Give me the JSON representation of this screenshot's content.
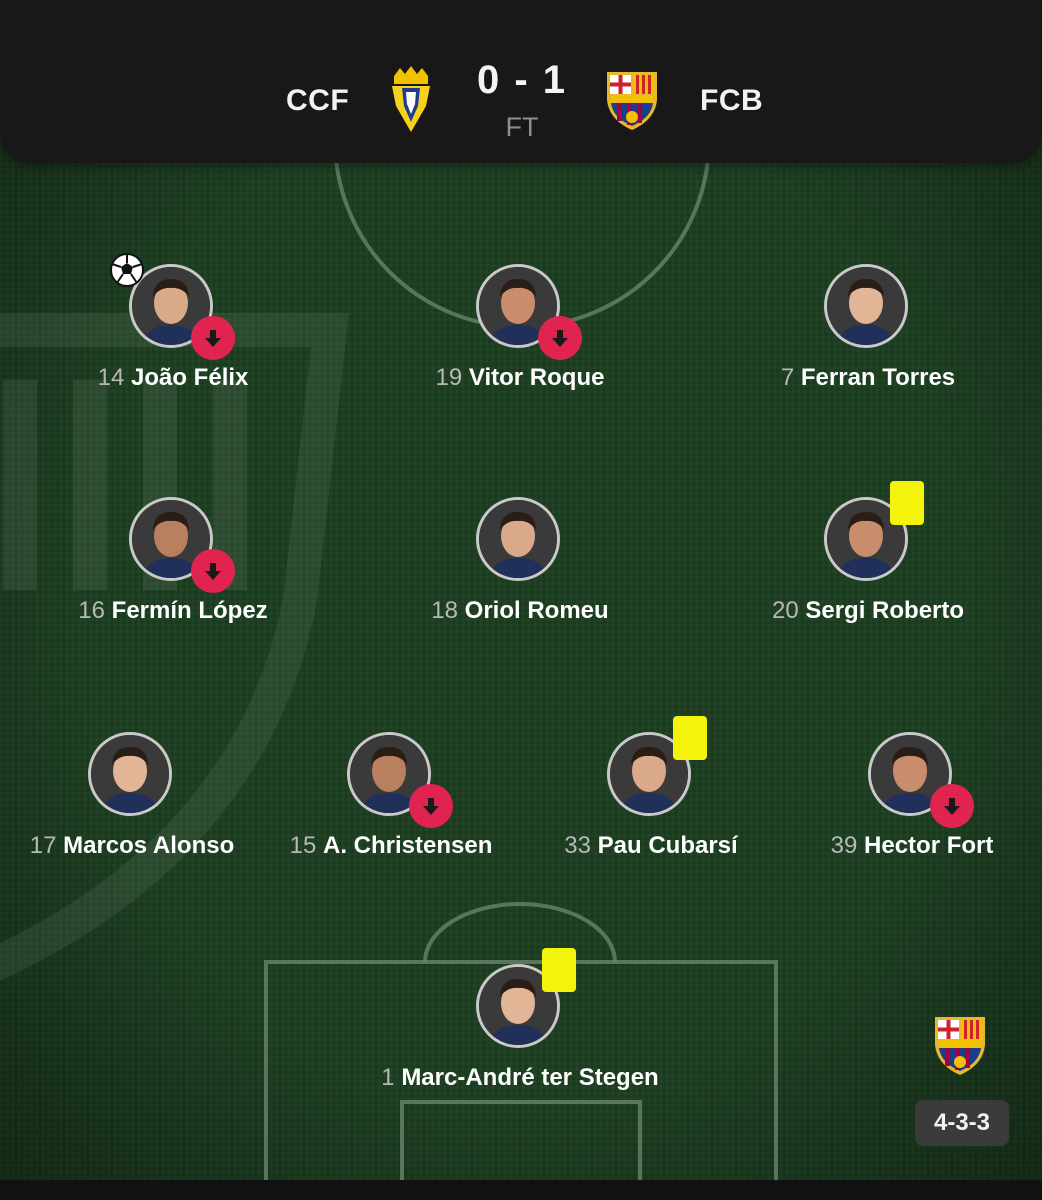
{
  "match": {
    "home_code": "CCF",
    "away_code": "FCB",
    "score": "0 - 1",
    "status": "FT"
  },
  "colors": {
    "pitch": "#1b3a1f",
    "header_bg": "#181818",
    "sub_off_badge": "#e1234f",
    "yellow_card": "#f3f30c",
    "badge_bg": "#3b3b3b"
  },
  "formation": "4-3-3",
  "players": [
    {
      "id": "joao-felix",
      "number": "14",
      "name": "João Félix",
      "icons": [
        "goal-ball-icon",
        "substitution-off-icon"
      ]
    },
    {
      "id": "vitor-roque",
      "number": "19",
      "name": "Vitor Roque",
      "icons": [
        "substitution-off-icon"
      ]
    },
    {
      "id": "ferran-torres",
      "number": "7",
      "name": "Ferran Torres",
      "icons": []
    },
    {
      "id": "fermin-lopez",
      "number": "16",
      "name": "Fermín López",
      "icons": [
        "substitution-off-icon"
      ]
    },
    {
      "id": "oriol-romeu",
      "number": "18",
      "name": "Oriol Romeu",
      "icons": []
    },
    {
      "id": "sergi-roberto",
      "number": "20",
      "name": "Sergi Roberto",
      "icons": [
        "yellow-card-icon"
      ]
    },
    {
      "id": "marcos-alonso",
      "number": "17",
      "name": "Marcos Alonso",
      "icons": []
    },
    {
      "id": "a-christensen",
      "number": "15",
      "name": "A. Christensen",
      "icons": [
        "substitution-off-icon"
      ]
    },
    {
      "id": "pau-cubarsi",
      "number": "33",
      "name": "Pau Cubarsí",
      "icons": [
        "yellow-card-icon"
      ]
    },
    {
      "id": "hector-fort",
      "number": "39",
      "name": "Hector Fort",
      "icons": [
        "substitution-off-icon"
      ]
    },
    {
      "id": "ter-stegen",
      "number": "1",
      "name": "Marc-André ter Stegen",
      "icons": [
        "yellow-card-icon"
      ]
    }
  ]
}
